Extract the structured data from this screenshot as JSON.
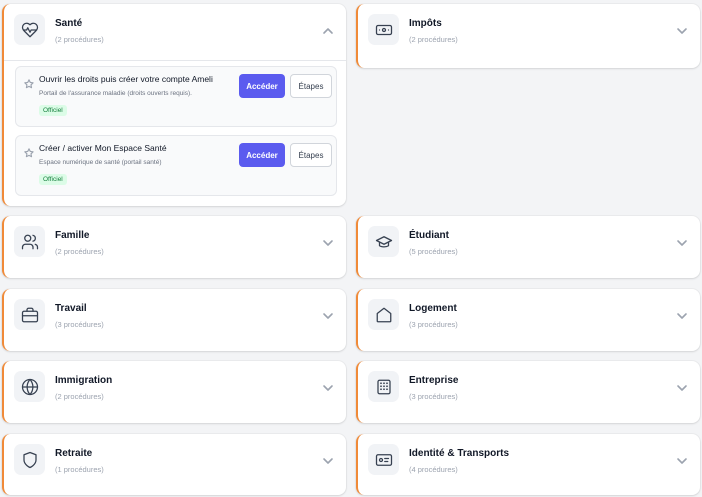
{
  "categories": {
    "sante": {
      "title": "Santé",
      "count": "(2 procédures)",
      "icon": "heart-pulse-icon",
      "procedures": [
        {
          "title": "Ouvrir les droits puis créer votre compte Ameli",
          "description": "Portail de l'assurance maladie (droits ouverts requis).",
          "badge": "Officiel",
          "primary": "Accéder",
          "secondary": "Étapes"
        },
        {
          "title": "Créer / activer Mon Espace Santé",
          "description": "Espace numérique de santé (portail santé)",
          "badge": "Officiel",
          "primary": "Accéder",
          "secondary": "Étapes"
        }
      ]
    },
    "impots": {
      "title": "Impôts",
      "count": "(2 procédures)",
      "icon": "banknote-icon"
    },
    "famille": {
      "title": "Famille",
      "count": "(2 procédures)",
      "icon": "users-icon"
    },
    "etudiant": {
      "title": "Étudiant",
      "count": "(5 procédures)",
      "icon": "graduation-cap-icon"
    },
    "travail": {
      "title": "Travail",
      "count": "(3 procédures)",
      "icon": "briefcase-icon"
    },
    "logement": {
      "title": "Logement",
      "count": "(3 procédures)",
      "icon": "house-icon"
    },
    "immigration": {
      "title": "Immigration",
      "count": "(2 procédures)",
      "icon": "globe-icon"
    },
    "entreprise": {
      "title": "Entreprise",
      "count": "(3 procédures)",
      "icon": "building-icon"
    },
    "retraite": {
      "title": "Retraite",
      "count": "(1 procédures)",
      "icon": "shield-icon"
    },
    "identite": {
      "title": "Identité & Transports",
      "count": "(4 procédures)",
      "icon": "id-card-icon"
    }
  },
  "colors": {
    "accent": "#f08a38",
    "primary_button": "#5b5bef",
    "badge_bg": "#dcfce7",
    "badge_text": "#15803d"
  }
}
